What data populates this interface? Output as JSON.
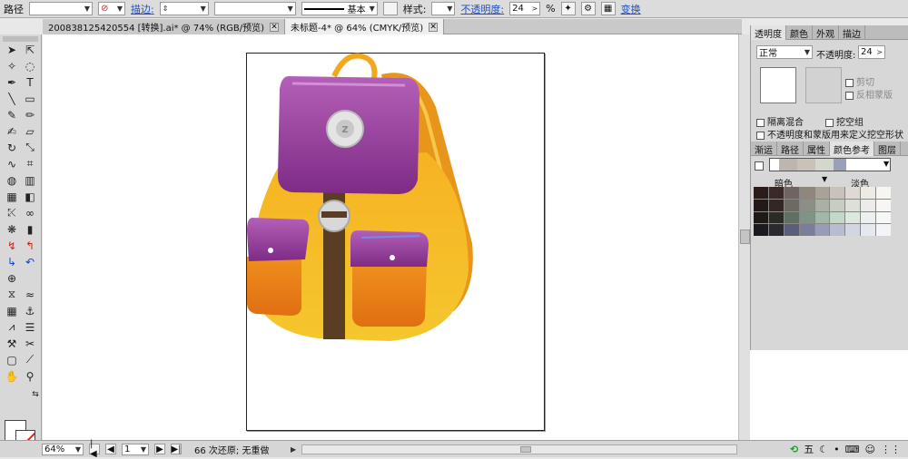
{
  "control_bar": {
    "path_label": "路径",
    "stroke_label": "描边:",
    "stroke_profile": "基本",
    "style_label": "样式:",
    "opacity_label": "不透明度:",
    "opacity_value": "24",
    "percent": "%",
    "transform_label": "变换"
  },
  "doc_tabs": [
    {
      "label": "200838125420554  [转换].ai* @ 74% (RGB/预览)"
    },
    {
      "label": "未标题-4* @ 64% (CMYK/预览)"
    }
  ],
  "transparency_panel": {
    "tabs": [
      "透明度",
      "颜色",
      "外观",
      "描边"
    ],
    "blend_mode": "正常",
    "opacity_label": "不透明度:",
    "opacity_value": "24",
    "clip_label": "剪切",
    "invert_mask_label": "反相蒙版",
    "isolate_blend_label": "隔离混合",
    "knockout_group_label": "挖空组",
    "opacity_mask_label": "不透明度和蒙版用来定义挖空形状"
  },
  "color_guide_panel": {
    "tabs": [
      "渐运",
      "路径",
      "属性",
      "颜色参考",
      "图层"
    ],
    "shades_label": "暗色",
    "tints_label": "淡色"
  },
  "status_bar": {
    "zoom": "64%",
    "artboard": "1",
    "status_text": "66 次还原; 无重做"
  },
  "tray": {
    "ime": "五"
  },
  "colors": {
    "bag_orange": "#f2a81d",
    "flap_purple": "#9a3f9e",
    "strap_brown": "#5a3d22",
    "link_blue": "#1f4fc4"
  }
}
